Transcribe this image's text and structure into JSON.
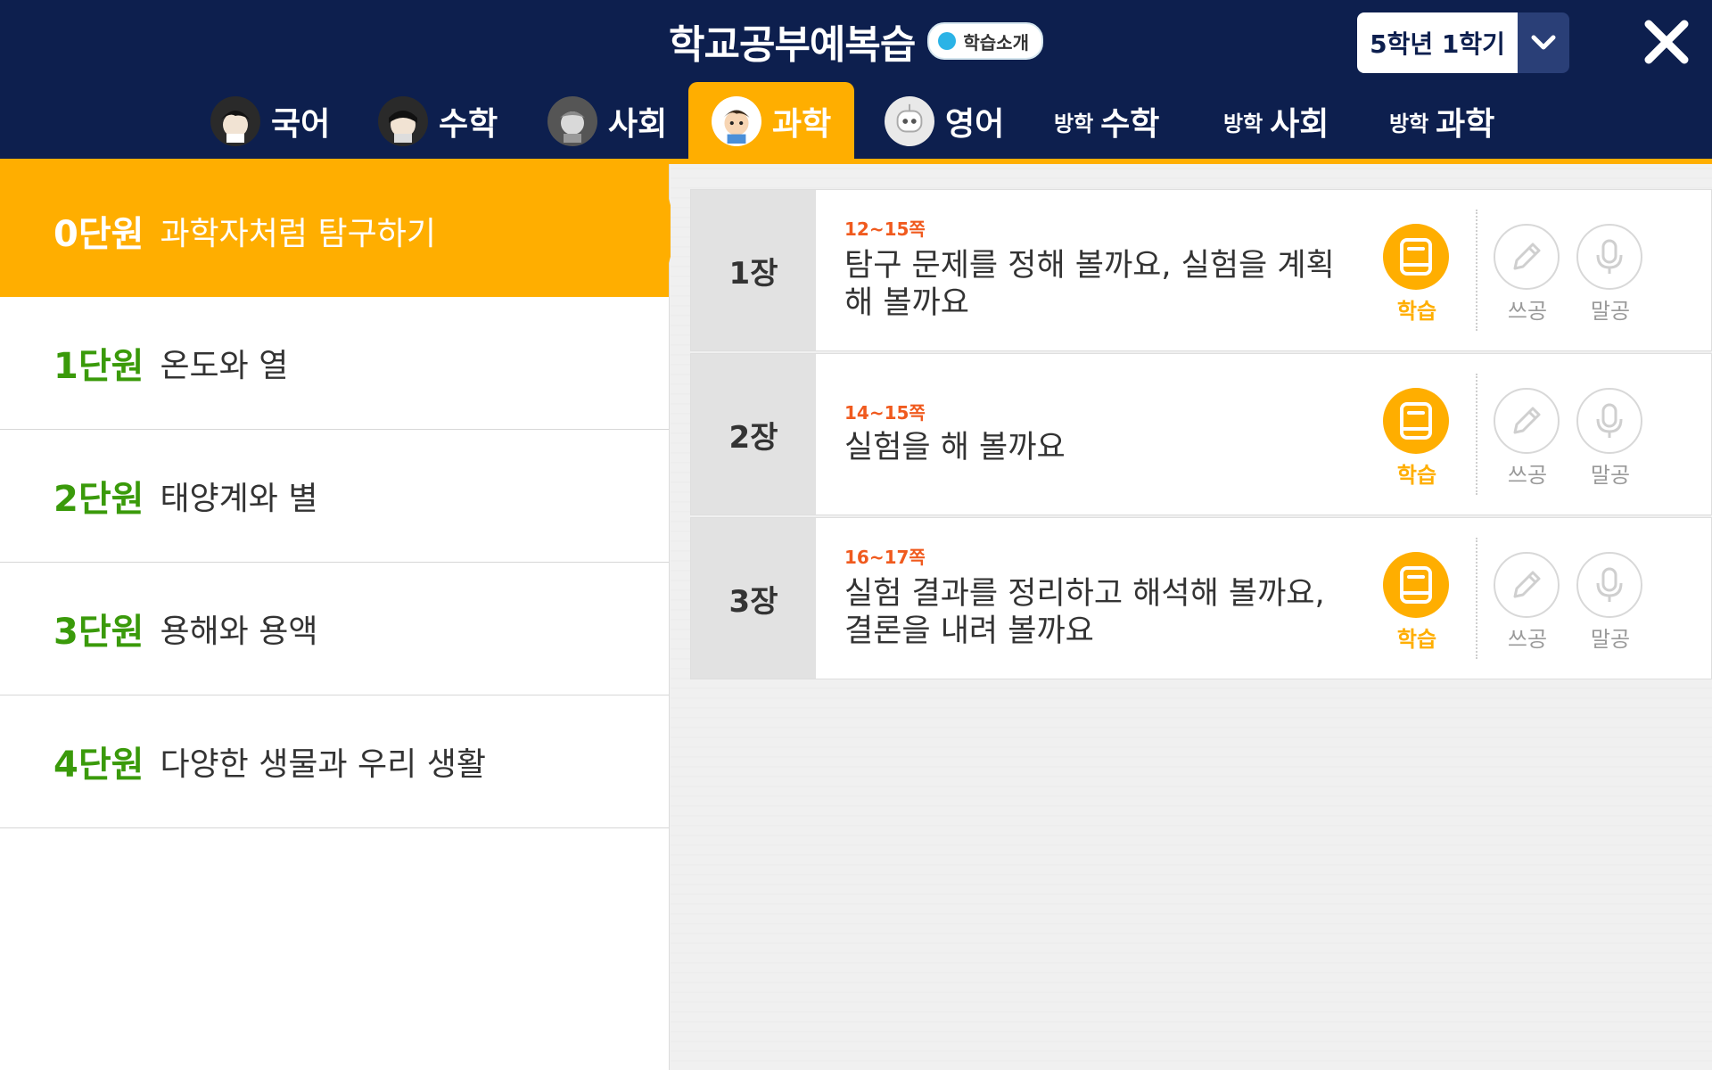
{
  "header": {
    "title": "학교공부예복습",
    "intro_label": "학습소개",
    "grade": "5학년 1학기",
    "colors": {
      "bg": "#0d1f4e",
      "accent": "#ffae00"
    }
  },
  "tabs": [
    {
      "label": "국어",
      "prefix": "",
      "icon": "avatar-icon"
    },
    {
      "label": "수학",
      "prefix": "",
      "icon": "avatar-icon"
    },
    {
      "label": "사회",
      "prefix": "",
      "icon": "avatar-icon"
    },
    {
      "label": "과학",
      "prefix": "",
      "icon": "avatar-icon",
      "active": true
    },
    {
      "label": "영어",
      "prefix": "",
      "icon": "robot-icon"
    },
    {
      "label": "수학",
      "prefix": "방학"
    },
    {
      "label": "사회",
      "prefix": "방학"
    },
    {
      "label": "과학",
      "prefix": "방학"
    }
  ],
  "units": [
    {
      "num": "0단원",
      "title": "과학자처럼 탐구하기",
      "active": true
    },
    {
      "num": "1단원",
      "title": "온도와 열"
    },
    {
      "num": "2단원",
      "title": "태양계와 별"
    },
    {
      "num": "3단원",
      "title": "용해와 용액"
    },
    {
      "num": "4단원",
      "title": "다양한 생물과 우리 생활"
    }
  ],
  "chapters": [
    {
      "num": "1장",
      "pages": "12~15쪽",
      "title": "탐구 문제를 정해 볼까요, 실험을 계획해 볼까요"
    },
    {
      "num": "2장",
      "pages": "14~15쪽",
      "title": "실험을 해 볼까요"
    },
    {
      "num": "3장",
      "pages": "16~17쪽",
      "title": "실험 결과를 정리하고 해석해 볼까요, 결론을 내려 볼까요"
    }
  ],
  "actions": {
    "study": "학습",
    "write": "쓰공",
    "speak": "말공"
  }
}
